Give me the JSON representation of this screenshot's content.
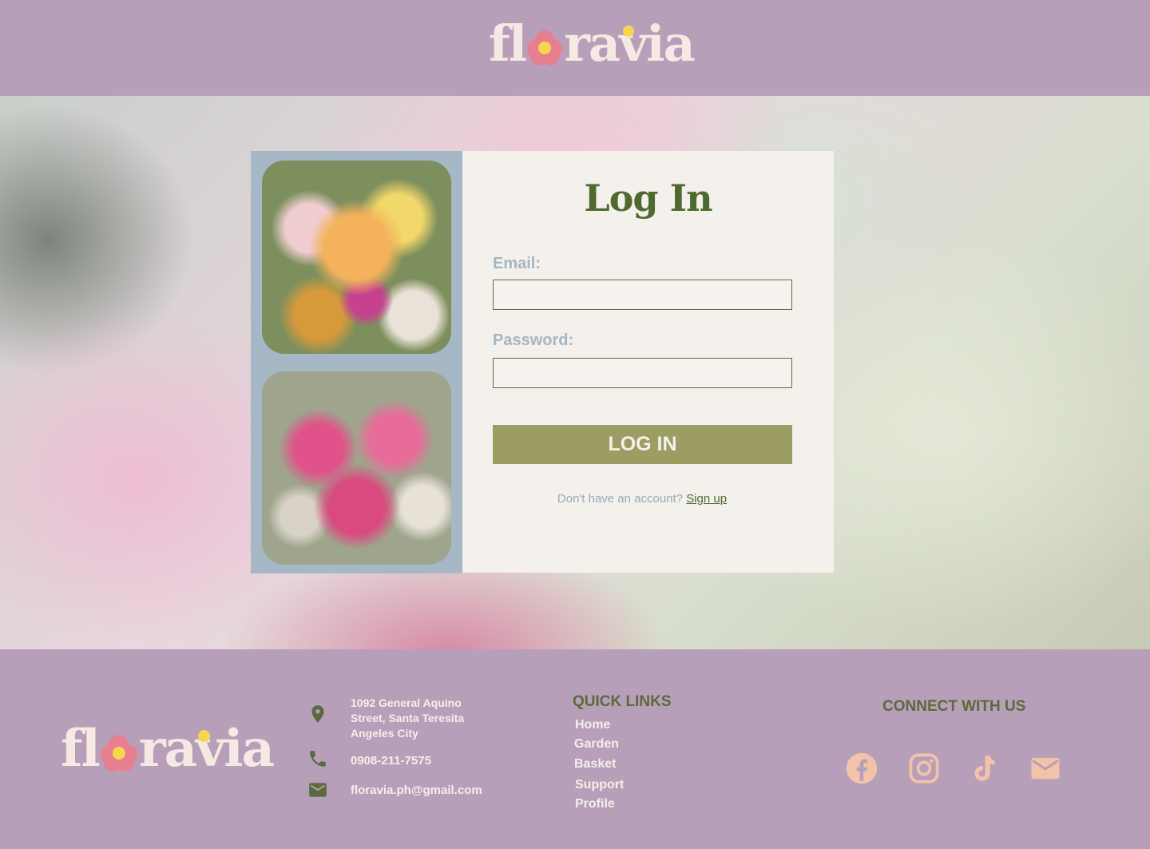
{
  "header": {
    "logo_text": "floravia"
  },
  "login": {
    "title": "Log In",
    "email_label": "Email:",
    "email_value": "",
    "password_label": "Password:",
    "password_value": "",
    "button_label": "LOG IN",
    "signup_prompt": "Don't have an account?",
    "signup_link": "Sign up"
  },
  "footer": {
    "logo_text": "floravia",
    "contact": {
      "address_line1": "1092 General Aquino",
      "address_line2": "Street, Santa Teresita",
      "address_line3": "Angeles City",
      "phone": "0908-211-7575",
      "email": "floravia.ph@gmail.com"
    },
    "quick_links_title": "QUICK LINKS",
    "quick_links": [
      "Home",
      "Garden",
      "Basket",
      "Support",
      "Profile"
    ],
    "connect_title": "CONNECT WITH US",
    "socials": [
      "facebook-icon",
      "instagram-icon",
      "tiktok-icon",
      "mail-icon"
    ]
  },
  "colors": {
    "brand_purple": "#b89fb9",
    "olive": "#4f6a2f",
    "button_olive": "#9b9d62",
    "cream": "#f4f0ec",
    "social_peach": "#f2c3a8",
    "flower_pink": "#e77f8f",
    "flower_yellow": "#f7d64f"
  }
}
